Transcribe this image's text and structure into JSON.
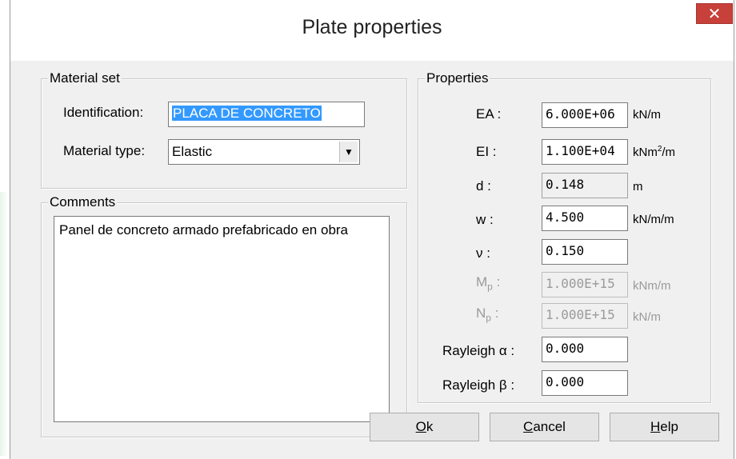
{
  "window": {
    "title": "Plate properties",
    "close_glyph": "✕"
  },
  "material_set": {
    "legend": "Material set",
    "identification_label": "Identification:",
    "identification_value": "PLACA DE CONCRETO",
    "material_type_label": "Material type:",
    "material_type_value": "Elastic"
  },
  "comments": {
    "legend": "Comments",
    "text": "Panel de concreto armado prefabricado en obra"
  },
  "properties": {
    "legend": "Properties",
    "ea": {
      "label": "EA :",
      "value": "6.000E+06",
      "unit": "kN/m"
    },
    "ei": {
      "label": "EI :",
      "value": "1.100E+04",
      "unit_base": "kNm",
      "unit_sup": "2",
      "unit_tail": "/m"
    },
    "d": {
      "label": "d :",
      "value": "0.148",
      "unit": "m"
    },
    "w": {
      "label": "w :",
      "value": "4.500",
      "unit": "kN/m/m"
    },
    "nu": {
      "label": "ν :",
      "value": "0.150"
    },
    "mp": {
      "label_base": "M",
      "label_sub": "p",
      "label_tail": " :",
      "value": "1.000E+15",
      "unit": "kNm/m"
    },
    "np": {
      "label_base": "N",
      "label_sub": "p",
      "label_tail": " :",
      "value": "1.000E+15",
      "unit": "kN/m"
    },
    "rayleigh_alpha": {
      "label": "Rayleigh α :",
      "value": "0.000"
    },
    "rayleigh_beta": {
      "label": "Rayleigh β :",
      "value": "0.000"
    }
  },
  "buttons": {
    "ok": {
      "mnemonic": "O",
      "rest": "k"
    },
    "cancel": {
      "mnemonic": "C",
      "rest": "ancel"
    },
    "help": {
      "mnemonic": "H",
      "rest": "elp"
    }
  }
}
